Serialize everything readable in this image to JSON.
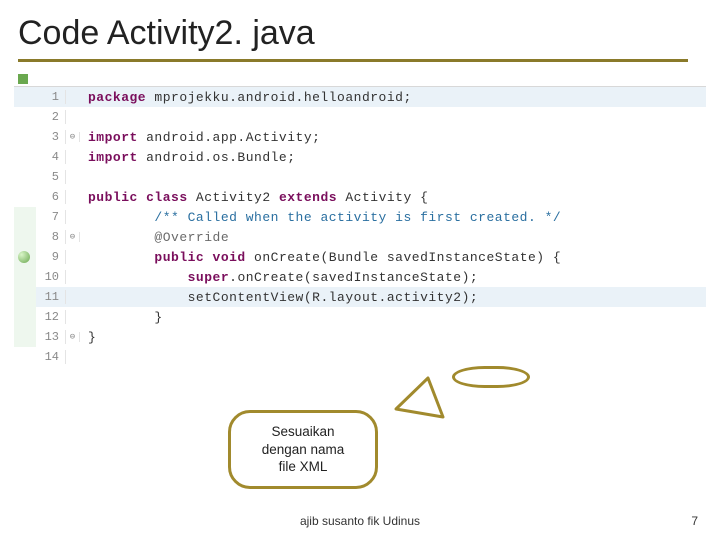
{
  "title": "Code Activity2. java",
  "code": {
    "lines": [
      {
        "n": "1",
        "fold": "",
        "marker": "",
        "kw": "package",
        "rest": " mprojekku.android.helloandroid;"
      },
      {
        "n": "2",
        "fold": "",
        "marker": "",
        "kw": "",
        "rest": ""
      },
      {
        "n": "3",
        "fold": "⊖",
        "marker": "",
        "kw": "import",
        "rest": " android.app.Activity;"
      },
      {
        "n": "4",
        "fold": "",
        "marker": "",
        "kw": "import",
        "rest": " android.os.Bundle;"
      },
      {
        "n": "5",
        "fold": "",
        "marker": "",
        "kw": "",
        "rest": ""
      },
      {
        "n": "6",
        "fold": "",
        "marker": "",
        "kw": "public class",
        "rest": " Activity2 ",
        "kw2": "extends",
        "rest2": " Activity {"
      },
      {
        "n": "7",
        "fold": "",
        "marker": "",
        "indent": "        ",
        "comment": "/** Called when the activity is first created. */"
      },
      {
        "n": "8",
        "fold": "⊖",
        "marker": "",
        "indent": "        ",
        "annotation": "@Override"
      },
      {
        "n": "9",
        "fold": "",
        "marker": "green",
        "indent": "        ",
        "kw": "public void",
        "rest": " onCreate(Bundle savedInstanceState) {"
      },
      {
        "n": "10",
        "fold": "",
        "marker": "",
        "indent": "            ",
        "kw": "super",
        "rest": ".onCreate(savedInstanceState);"
      },
      {
        "n": "11",
        "fold": "",
        "marker": "",
        "indent": "            ",
        "rest": "setContentView(R.layout.",
        "hi": "activity2",
        "rest2": ");"
      },
      {
        "n": "12",
        "fold": "",
        "marker": "",
        "indent": "        ",
        "rest": "}"
      },
      {
        "n": "13",
        "fold": "⊖",
        "marker": "",
        "rest": "}"
      },
      {
        "n": "14",
        "fold": "",
        "marker": "",
        "rest": ""
      }
    ]
  },
  "callout": {
    "line1": "Sesuaikan",
    "line2": "dengan nama",
    "line3": "file XML"
  },
  "footer": "ajib susanto fik Udinus",
  "page": "7"
}
